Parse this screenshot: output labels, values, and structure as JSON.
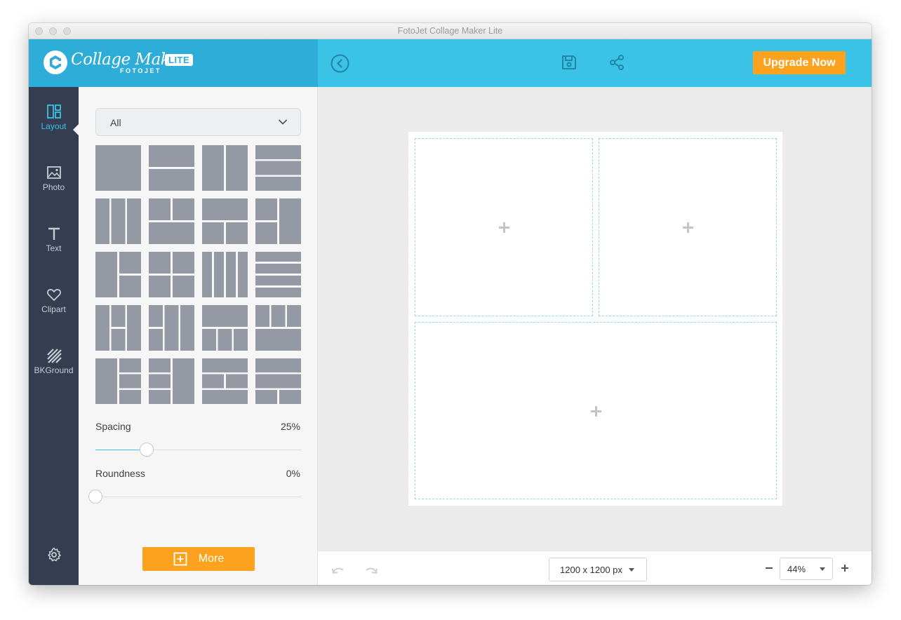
{
  "window": {
    "title": "FotoJet Collage Maker Lite"
  },
  "brand": {
    "script_text": "Collage Maker",
    "sub_text": "FOTOJET",
    "badge": "LITE"
  },
  "toolbar": {
    "back_icon": "chevron-left-circle-icon",
    "save_icon": "floppy-disk-icon",
    "share_icon": "share-icon",
    "upgrade_label": "Upgrade Now"
  },
  "sidebar": {
    "items": [
      {
        "label": "Layout",
        "icon": "layout-icon",
        "active": true
      },
      {
        "label": "Photo",
        "icon": "image-icon",
        "active": false
      },
      {
        "label": "Text",
        "icon": "text-icon",
        "active": false
      },
      {
        "label": "Clipart",
        "icon": "heart-icon",
        "active": false
      },
      {
        "label": "BKGround",
        "icon": "background-stripes-icon",
        "active": false
      }
    ],
    "settings_icon": "gear-icon"
  },
  "panel": {
    "filter": {
      "selected": "All"
    },
    "spacing": {
      "label": "Spacing",
      "value_text": "25%",
      "value": 0.25
    },
    "roundness": {
      "label": "Roundness",
      "value_text": "0%",
      "value": 0
    },
    "more_label": "More"
  },
  "canvas": {
    "cells": 3
  },
  "bottombar": {
    "undo_icon": "undo-icon",
    "redo_icon": "redo-icon",
    "canvas_size": "1200 x 1200 px",
    "zoom_out_label": "−",
    "zoom": "44%",
    "zoom_in_label": "+"
  },
  "colors": {
    "accent": "#3bc2e7",
    "header_left": "#2fadd9",
    "sidebar_bg": "#353e50",
    "orange": "#fca21f",
    "thumb": "#9599a3"
  }
}
